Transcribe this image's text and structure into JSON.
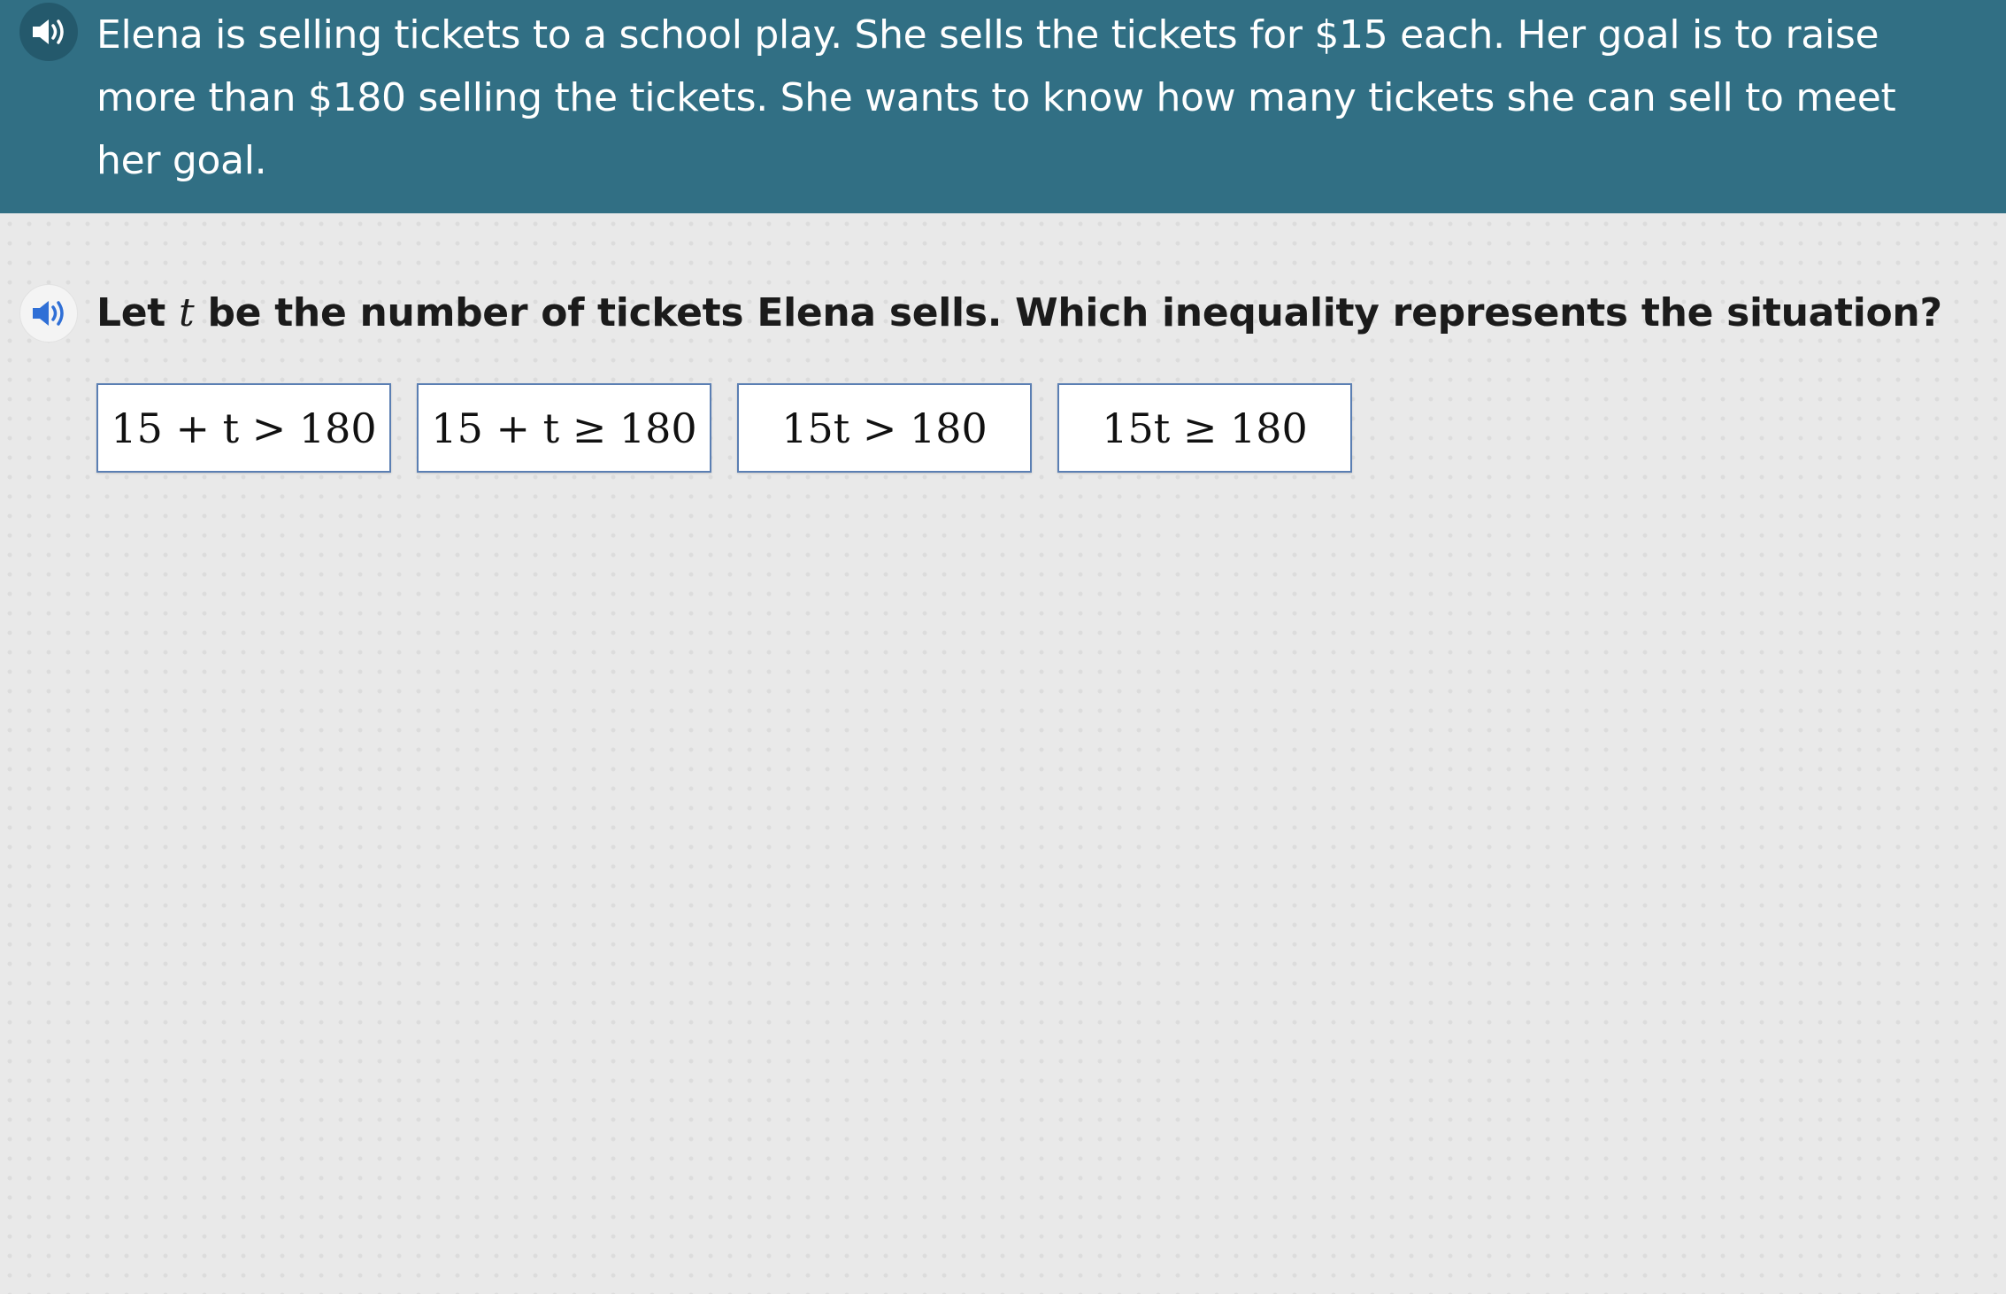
{
  "passage": {
    "audio_icon": "speaker-icon",
    "text": "Elena is selling tickets to a school play. She sells the tickets for $15 each. Her goal is to raise more than $180 selling the tickets. She wants to know how many tickets she can sell to meet her goal."
  },
  "question": {
    "audio_icon": "speaker-icon",
    "text_before": "Let ",
    "variable": "t",
    "text_after": " be the number of tickets Elena sells. Which inequality represents the situation?"
  },
  "choices": [
    {
      "label": "15 + t > 180"
    },
    {
      "label": "15 + t ≥ 180"
    },
    {
      "label": "15t > 180"
    },
    {
      "label": "15t ≥ 180"
    }
  ],
  "colors": {
    "header_bg": "#316f84",
    "page_bg": "#e9e9e9",
    "choice_border": "#5b7fb3",
    "speaker_active": "#2f6fd6"
  }
}
